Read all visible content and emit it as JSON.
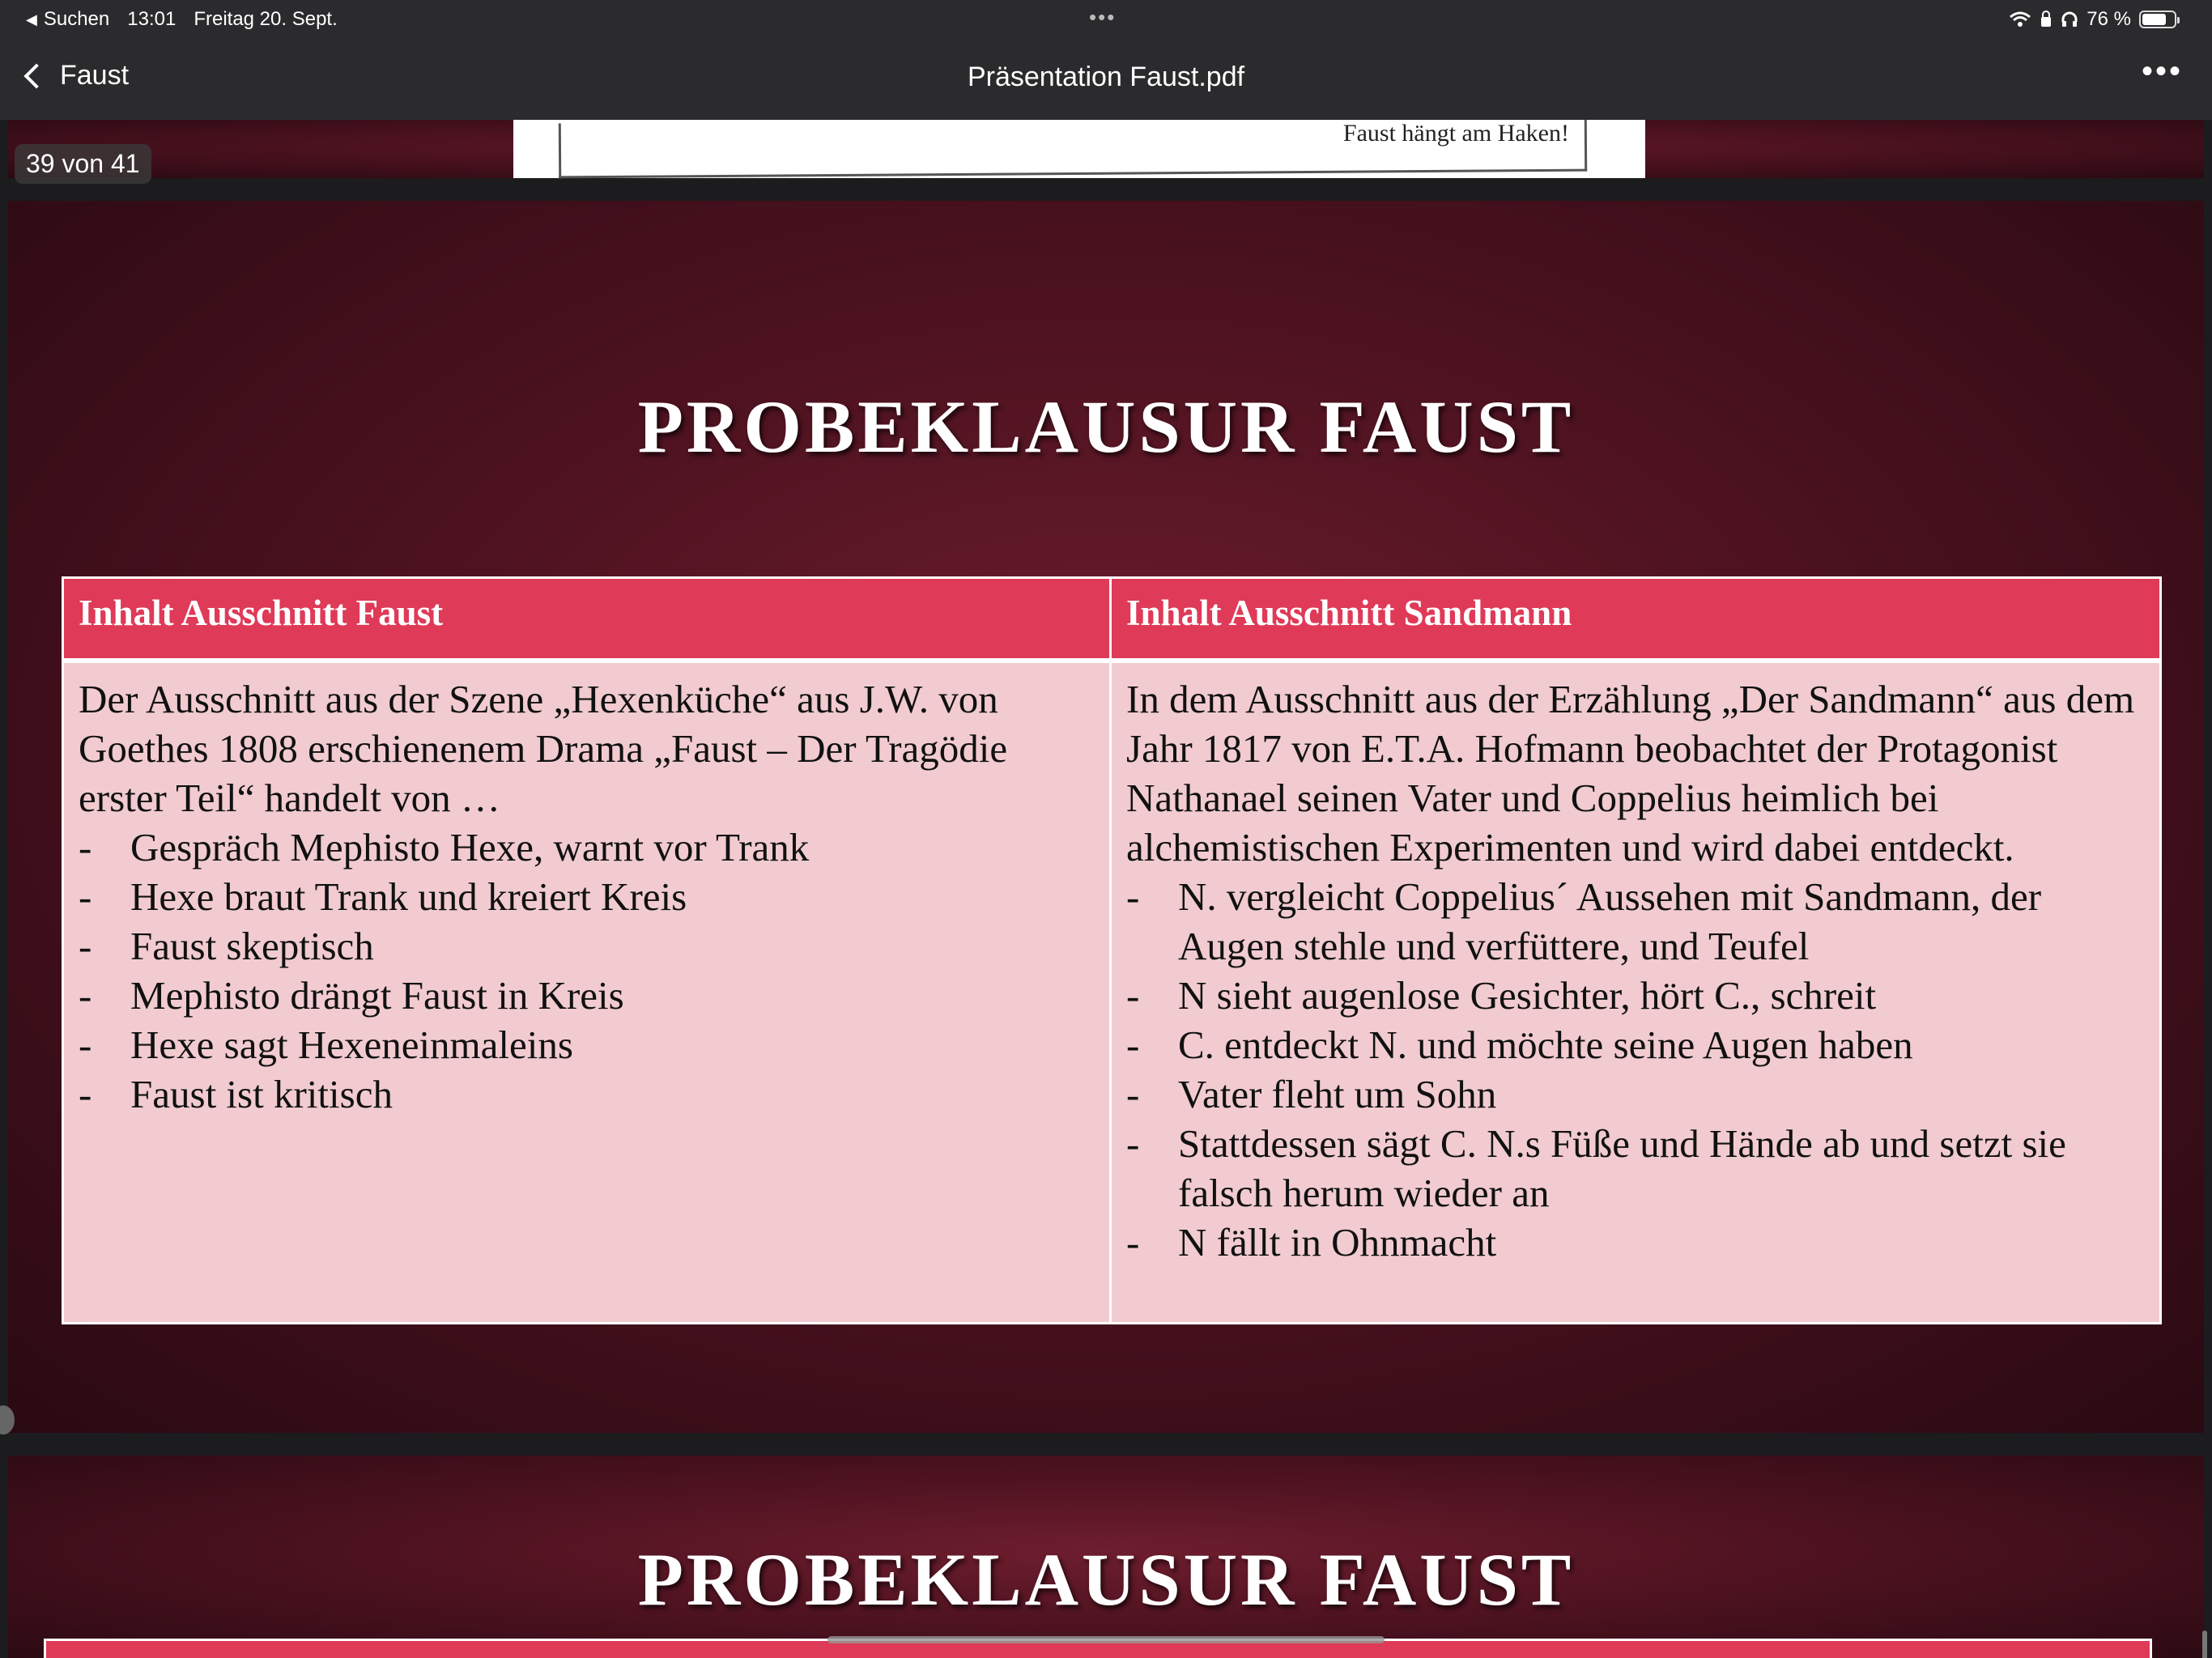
{
  "status_bar": {
    "back_app": "Suchen",
    "time": "13:01",
    "date": "Freitag 20. Sept.",
    "dots": "•••",
    "battery_percent": "76 %",
    "battery_level": 0.76
  },
  "nav": {
    "back_label": "Faust",
    "title": "Präsentation Faust.pdf",
    "more": "•••"
  },
  "viewer": {
    "page_indicator": "39 von 41",
    "prev_caption": "Faust hängt am Haken!"
  },
  "slide": {
    "title": "PROBEKLAUSUR FAUST",
    "col1_head": "Inhalt Ausschnitt Faust",
    "col2_head": "Inhalt Ausschnitt Sandmann",
    "col1_intro": "Der Ausschnitt aus der Szene „Hexenküche“ aus J.W. von Goethes 1808 erschienenem Drama „Faust – Der Tragödie erster Teil“ handelt von …",
    "col1_items": [
      "Gespräch Mephisto Hexe, warnt vor Trank",
      "Hexe braut Trank und kreiert Kreis",
      "Faust skeptisch",
      "Mephisto drängt Faust in Kreis",
      "Hexe sagt Hexeneinmaleins",
      "Faust ist kritisch"
    ],
    "col2_intro": "In dem Ausschnitt aus der Erzählung „Der Sandmann“ aus dem Jahr 1817 von E.T.A. Hofmann beobachtet der Protagonist Nathanael seinen Vater und Coppelius heimlich bei alchemistischen Experimenten und wird dabei entdeckt.",
    "col2_items": [
      "N. vergleicht Coppelius´ Aussehen mit Sandmann, der Augen stehle und verfüttere, und Teufel",
      "N sieht augenlose Gesichter, hört C., schreit",
      "C. entdeckt N. und möchte seine Augen haben",
      "Vater fleht um Sohn",
      "Stattdessen sägt C. N.s Füße und Hände ab und setzt sie falsch herum wieder an",
      "N fällt in Ohnmacht"
    ]
  },
  "next_slide": {
    "title": "PROBEKLAUSUR FAUST"
  }
}
